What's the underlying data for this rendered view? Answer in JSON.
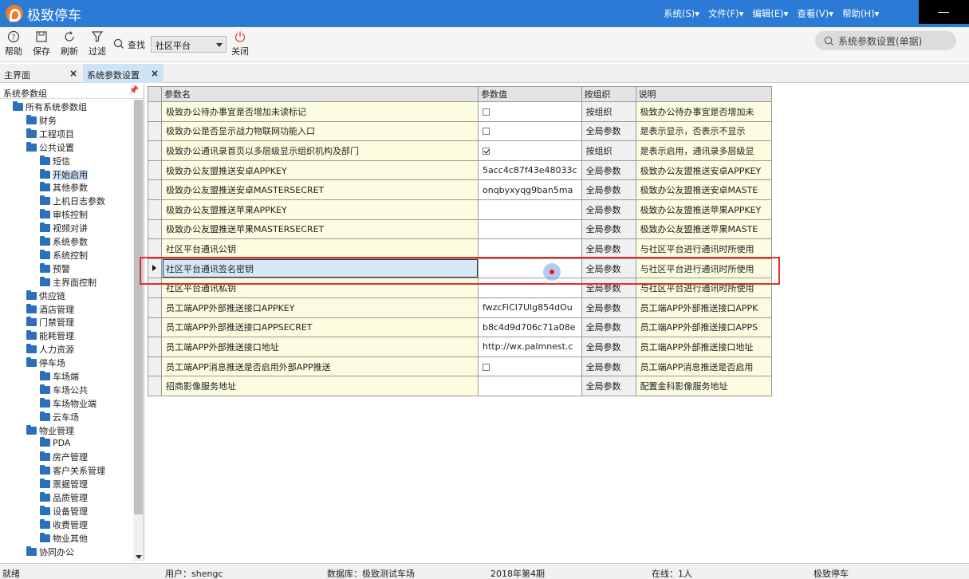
{
  "app": {
    "title": "极致停车",
    "menus": [
      "系统(S)▾",
      "文件(F)▾",
      "编辑(E)▾",
      "查看(V)▾",
      "帮助(H)▾"
    ]
  },
  "toolbar": {
    "help": "帮助",
    "save": "保存",
    "refresh": "刷新",
    "filter": "过滤",
    "search_label": "查找",
    "combo_value": "社区平台",
    "close": "关闭",
    "right_search": "系统参数设置(单据)"
  },
  "tabs": [
    {
      "label": "主界面",
      "close": "×"
    },
    {
      "label": "系统参数设置",
      "close": "×"
    }
  ],
  "tree": {
    "title": "系统参数组",
    "pin": "ꟸ",
    "nodes": [
      {
        "label": "所有系统参数组"
      },
      {
        "label": "财务"
      },
      {
        "label": "工程项目"
      },
      {
        "label": "公共设置"
      },
      {
        "label": "短信"
      },
      {
        "label": "开始启用"
      },
      {
        "label": "其他参数"
      },
      {
        "label": "上机日志参数"
      },
      {
        "label": "审核控制"
      },
      {
        "label": "视频对讲"
      },
      {
        "label": "系统参数"
      },
      {
        "label": "系统控制"
      },
      {
        "label": "预警"
      },
      {
        "label": "主界面控制"
      },
      {
        "label": "供应链"
      },
      {
        "label": "酒店管理"
      },
      {
        "label": "门禁管理"
      },
      {
        "label": "能耗管理"
      },
      {
        "label": "人力资源"
      },
      {
        "label": "停车场"
      },
      {
        "label": "车场端"
      },
      {
        "label": "车场公共"
      },
      {
        "label": "车场物业端"
      },
      {
        "label": "云车场"
      },
      {
        "label": "物业管理"
      },
      {
        "label": "PDA"
      },
      {
        "label": "房产管理"
      },
      {
        "label": "客户关系管理"
      },
      {
        "label": "票据管理"
      },
      {
        "label": "品质管理"
      },
      {
        "label": "设备管理"
      },
      {
        "label": "收费管理"
      },
      {
        "label": "物业其他"
      },
      {
        "label": "协同办公"
      }
    ]
  },
  "grid": {
    "headers": [
      "参数名",
      "参数值",
      "按组织",
      "说明"
    ],
    "rows": [
      {
        "name": "极致办公待办事宜是否增加未读标记",
        "value": "",
        "check": "off",
        "scope": "按组织",
        "desc": "极致办公待办事宜是否增加未"
      },
      {
        "name": "极致办公是否显示战力物联网功能入口",
        "value": "",
        "check": "off",
        "scope": "全局参数",
        "desc": "是表示显示，否表示不显示"
      },
      {
        "name": "极致办公通讯录首页以多层级显示组织机构及部门",
        "value": "",
        "check": "on",
        "scope": "按组织",
        "desc": "是表示启用，通讯录多层级显"
      },
      {
        "name": "极致办公友盟推送安卓APPKEY",
        "value": "5acc4c87f43e48033c",
        "scope": "全局参数",
        "desc": "极致办公友盟推送安卓APPKEY"
      },
      {
        "name": "极致办公友盟推送安卓MASTERSECRET",
        "value": "onqbyxyqg9ban5ma",
        "scope": "全局参数",
        "desc": "极致办公友盟推送安卓MASTE"
      },
      {
        "name": "极致办公友盟推送苹果APPKEY",
        "value": "",
        "scope": "全局参数",
        "desc": "极致办公友盟推送苹果APPKEY"
      },
      {
        "name": "极致办公友盟推送苹果MASTERSECRET",
        "value": "",
        "scope": "全局参数",
        "desc": "极致办公友盟推送苹果MASTE"
      },
      {
        "name": "社区平台通讯公钥",
        "value": "",
        "scope": "全局参数",
        "desc": "与社区平台进行通讯时所使用"
      },
      {
        "name": "社区平台通讯签名密钥",
        "value": "",
        "scope": "全局参数",
        "desc": "与社区平台进行通讯时所使用",
        "current": true
      },
      {
        "name": "社区平台通讯私钥",
        "value": "",
        "scope": "全局参数",
        "desc": "与社区平台进行通讯时所使用"
      },
      {
        "name": "员工端APP外部推送接口APPKEY",
        "value": "fwzcFiCI7Ulg854dOu",
        "scope": "全局参数",
        "desc": "员工端APP外部推送接口APPK"
      },
      {
        "name": "员工端APP外部推送接口APPSECRET",
        "value": "b8c4d9d706c71a08e",
        "scope": "全局参数",
        "desc": "员工端APP外部推送接口APPS"
      },
      {
        "name": "员工端APP外部推送接口地址",
        "value": "http://wx.palmnest.c",
        "scope": "全局参数",
        "desc": "员工端APP外部推送接口地址"
      },
      {
        "name": "员工端APP消息推送是否启用外部APP推送",
        "value": "",
        "check": "off",
        "scope": "全局参数",
        "desc": "员工端APP消息推送是否启用"
      },
      {
        "name": "招商影像服务地址",
        "value": "",
        "scope": "全局参数",
        "desc": "配置金科影像服务地址"
      }
    ]
  },
  "status": {
    "ready": "就绪",
    "user": "用户：shengc",
    "db": "数据库：极致测试车场",
    "period": "2018年第4期",
    "online": "在线：1人",
    "brand": "极致停车"
  }
}
